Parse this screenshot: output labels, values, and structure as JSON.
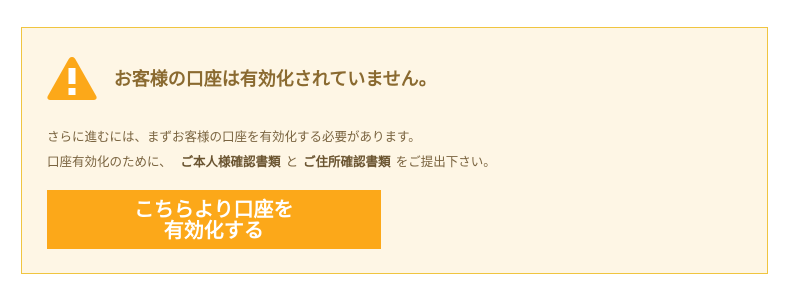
{
  "alert": {
    "icon": "warning-triangle-icon",
    "title": "お客様の口座は有効化されていません。",
    "line1": "さらに進むには、まずお客様の口座を有効化する必要があります。",
    "line2_prefix": "口座有効化のために、",
    "id_document": "ご本人様確認書類",
    "conjunction": "と",
    "address_document": "ご住所確認書類",
    "line2_suffix": "をご提出下さい。"
  },
  "cta": {
    "line1": "こちらより口座を",
    "line2": "有効化する"
  },
  "colors": {
    "panel_bg": "#fef6e5",
    "panel_border": "#f0c540",
    "icon": "#fca819",
    "title": "#8a6a30",
    "button_bg": "#fca819",
    "button_text": "#ffffff"
  }
}
